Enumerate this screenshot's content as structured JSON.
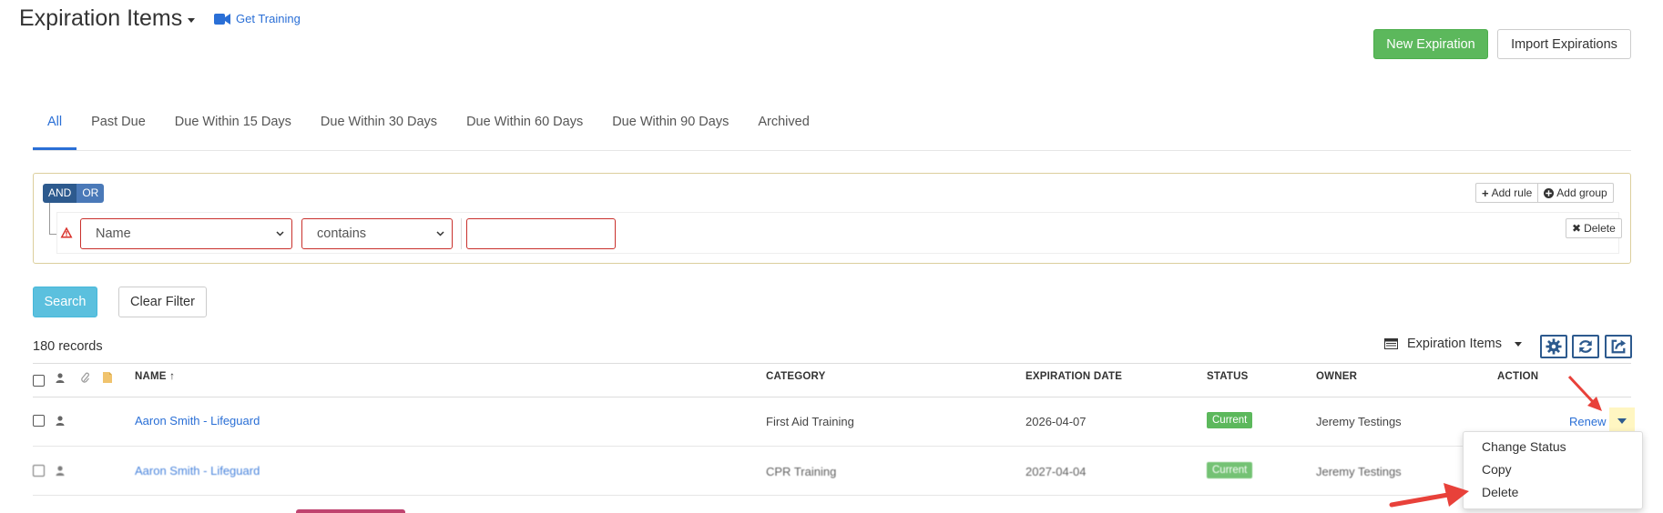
{
  "header": {
    "title": "Expiration Items",
    "training_link": "Get Training",
    "new_button": "New Expiration",
    "import_button": "Import Expirations"
  },
  "tabs": [
    {
      "label": "All",
      "active": true
    },
    {
      "label": "Past Due"
    },
    {
      "label": "Due Within 15 Days"
    },
    {
      "label": "Due Within 30 Days"
    },
    {
      "label": "Due Within 60 Days"
    },
    {
      "label": "Due Within 90 Days"
    },
    {
      "label": "Archived"
    }
  ],
  "filter": {
    "and_label": "AND",
    "or_label": "OR",
    "add_rule": "Add rule",
    "add_group": "Add group",
    "delete_label": "Delete",
    "rule": {
      "field": "Name",
      "operator": "contains",
      "value": ""
    },
    "search_button": "Search",
    "clear_button": "Clear Filter"
  },
  "grid": {
    "records": "180 records",
    "view_name": "Expiration Items",
    "columns": {
      "name": "NAME",
      "sort_indicator": "↑",
      "category": "CATEGORY",
      "expiration_date": "EXPIRATION DATE",
      "status": "STATUS",
      "owner": "OWNER",
      "action": "ACTION"
    },
    "rows": [
      {
        "name": "Aaron Smith - Lifeguard",
        "category": "First Aid Training",
        "expiration_date": "2026-04-07",
        "status": "Current",
        "owner": "Jeremy Testings",
        "action": "Renew"
      },
      {
        "name": "Aaron Smith - Lifeguard",
        "category": "CPR Training",
        "expiration_date": "2027-04-04",
        "status": "Current",
        "owner": "Jeremy Testings"
      }
    ],
    "action_menu": [
      "Change Status",
      "Copy",
      "Delete"
    ]
  },
  "colors": {
    "accent": "#2a6fd6",
    "success": "#5cb85c",
    "info": "#5bc0de",
    "danger": "#c9302c",
    "annotation_arrow": "#e8413a",
    "highlight": "#fff6c2"
  }
}
